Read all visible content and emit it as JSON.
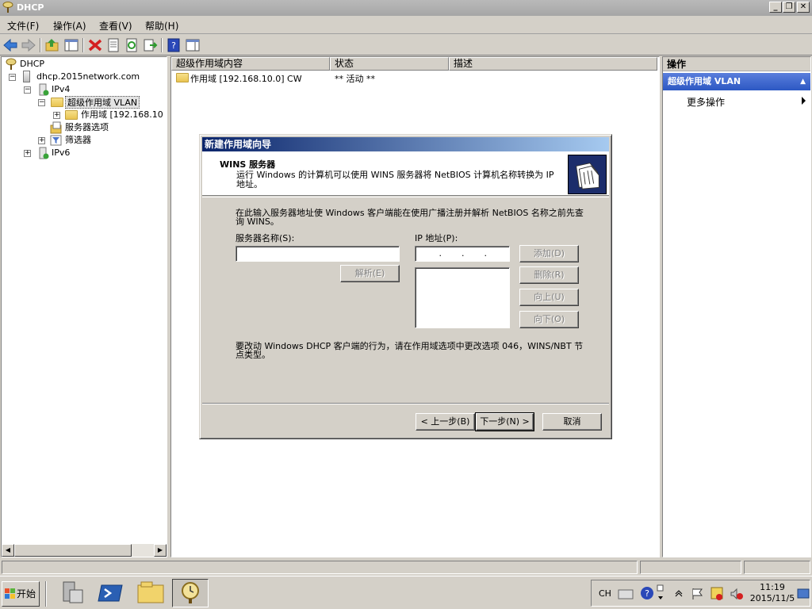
{
  "window": {
    "title": "DHCP"
  },
  "menu": [
    {
      "label": "文件(F)"
    },
    {
      "label": "操作(A)"
    },
    {
      "label": "查看(V)"
    },
    {
      "label": "帮助(H)"
    }
  ],
  "tree": {
    "root": "DHCP",
    "server": "dhcp.2015network.com",
    "ipv4": "IPv4",
    "superscope": "超级作用域 VLAN",
    "scope": "作用域 [192.168.10",
    "server_options": "服务器选项",
    "filters": "筛选器",
    "ipv6": "IPv6"
  },
  "list": {
    "columns": [
      {
        "label": "超级作用域内容"
      },
      {
        "label": "状态"
      },
      {
        "label": "描述"
      }
    ],
    "rows": [
      {
        "content": "作用域 [192.168.10.0] CW",
        "status": "** 活动 **",
        "description": ""
      }
    ]
  },
  "actions": {
    "header": "操作",
    "section": "超级作用域 VLAN",
    "more": "更多操作"
  },
  "dialog": {
    "title": "新建作用域向导",
    "heading": "WINS 服务器",
    "subheading": "运行 Windows 的计算机可以使用 WINS 服务器将 NetBIOS 计算机名称转换为 IP 地址。",
    "intro": "在此输入服务器地址使 Windows 客户端能在使用广播注册并解析 NetBIOS 名称之前先查询 WINS。",
    "server_name_label": "服务器名称(S):",
    "server_name_value": "",
    "ip_label": "IP 地址(P):",
    "ip_value": " .  .  . ",
    "resolve": "解析(E)",
    "add": "添加(D)",
    "remove": "删除(R)",
    "up": "向上(U)",
    "down": "向下(O)",
    "note": "要改动 Windows DHCP 客户端的行为，请在作用域选项中更改选项 046，WINS/NBT 节点类型。",
    "back": "< 上一步(B)",
    "next": "下一步(N) >",
    "cancel": "取消"
  },
  "taskbar": {
    "start": "开始",
    "lang": "CH",
    "time": "11:19",
    "date": "2015/11/5"
  },
  "colors": {
    "dialog_title_start": "#0a246a",
    "dialog_title_end": "#a6caf0",
    "action_section": "#2c58c3",
    "face": "#d4d0c8"
  }
}
